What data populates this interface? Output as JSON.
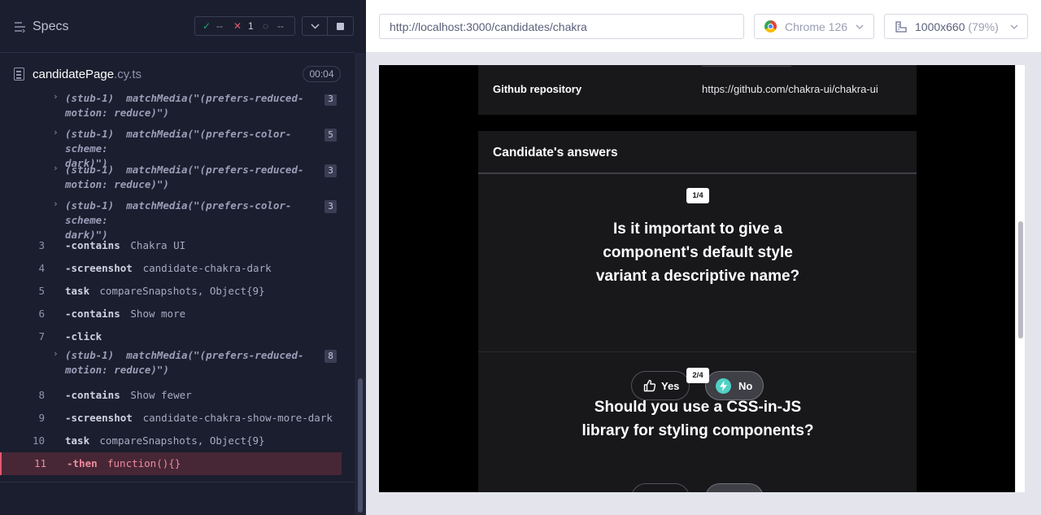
{
  "reporter": {
    "title": "Specs",
    "stats": {
      "passed": "--",
      "failed": "1",
      "pending": "--"
    },
    "spec_file": {
      "name": "candidatePage",
      "ext": ".cy.ts",
      "duration": "00:04"
    },
    "commands": [
      {
        "type": "stub",
        "text": "(stub-1)  matchMedia(\"(prefers-reduced-\nmotion: reduce)\")",
        "count": "3"
      },
      {
        "type": "stub",
        "text": "(stub-1)  matchMedia(\"(prefers-color-scheme:\ndark)\")",
        "count": "5"
      },
      {
        "type": "stub",
        "text": "(stub-1)  matchMedia(\"(prefers-reduced-\nmotion: reduce)\")",
        "count": "3"
      },
      {
        "type": "stub",
        "text": "(stub-1)  matchMedia(\"(prefers-color-scheme:\ndark)\")",
        "count": "3"
      },
      {
        "type": "cmd",
        "num": "3",
        "name": "-contains",
        "msg": "Chakra UI"
      },
      {
        "type": "cmd",
        "num": "4",
        "name": "-screenshot",
        "msg": "candidate-chakra-dark"
      },
      {
        "type": "cmd",
        "num": "5",
        "name": "task",
        "msg": "compareSnapshots, Object{9}"
      },
      {
        "type": "cmd",
        "num": "6",
        "name": "-contains",
        "msg": "Show more"
      },
      {
        "type": "cmd",
        "num": "7",
        "name": "-click",
        "msg": ""
      },
      {
        "type": "stub",
        "text": "(stub-1)  matchMedia(\"(prefers-reduced-\nmotion: reduce)\")",
        "count": "8"
      },
      {
        "type": "cmd",
        "num": "8",
        "name": "-contains",
        "msg": "Show fewer"
      },
      {
        "type": "cmd",
        "num": "9",
        "name": "-screenshot",
        "msg": "candidate-chakra-show-more-dark"
      },
      {
        "type": "cmd",
        "num": "10",
        "name": "task",
        "msg": "compareSnapshots, Object{9}"
      },
      {
        "type": "fail",
        "num": "11",
        "name": "-then",
        "msg": "function(){}"
      }
    ]
  },
  "toolbar": {
    "url": "http://localhost:3000/candidates/chakra",
    "browser": "Chrome 126",
    "viewport": "1000x660",
    "viewport_scale": "(79%)"
  },
  "app": {
    "repo_label": "Github repository",
    "repo_value": "https://github.com/chakra-ui/chakra-ui",
    "answers_title": "Candidate's answers",
    "questions": [
      {
        "tag": "1/4",
        "text": "Is it important to give a component's default style variant a descriptive name?",
        "yes": "Yes",
        "no": "No"
      },
      {
        "tag": "2/4",
        "text": "Should you use a CSS-in-JS library for styling components?"
      }
    ]
  },
  "colors": {
    "fail": "#e45770",
    "pass": "#1fa971",
    "accent_teal": "#4fd1c5"
  }
}
